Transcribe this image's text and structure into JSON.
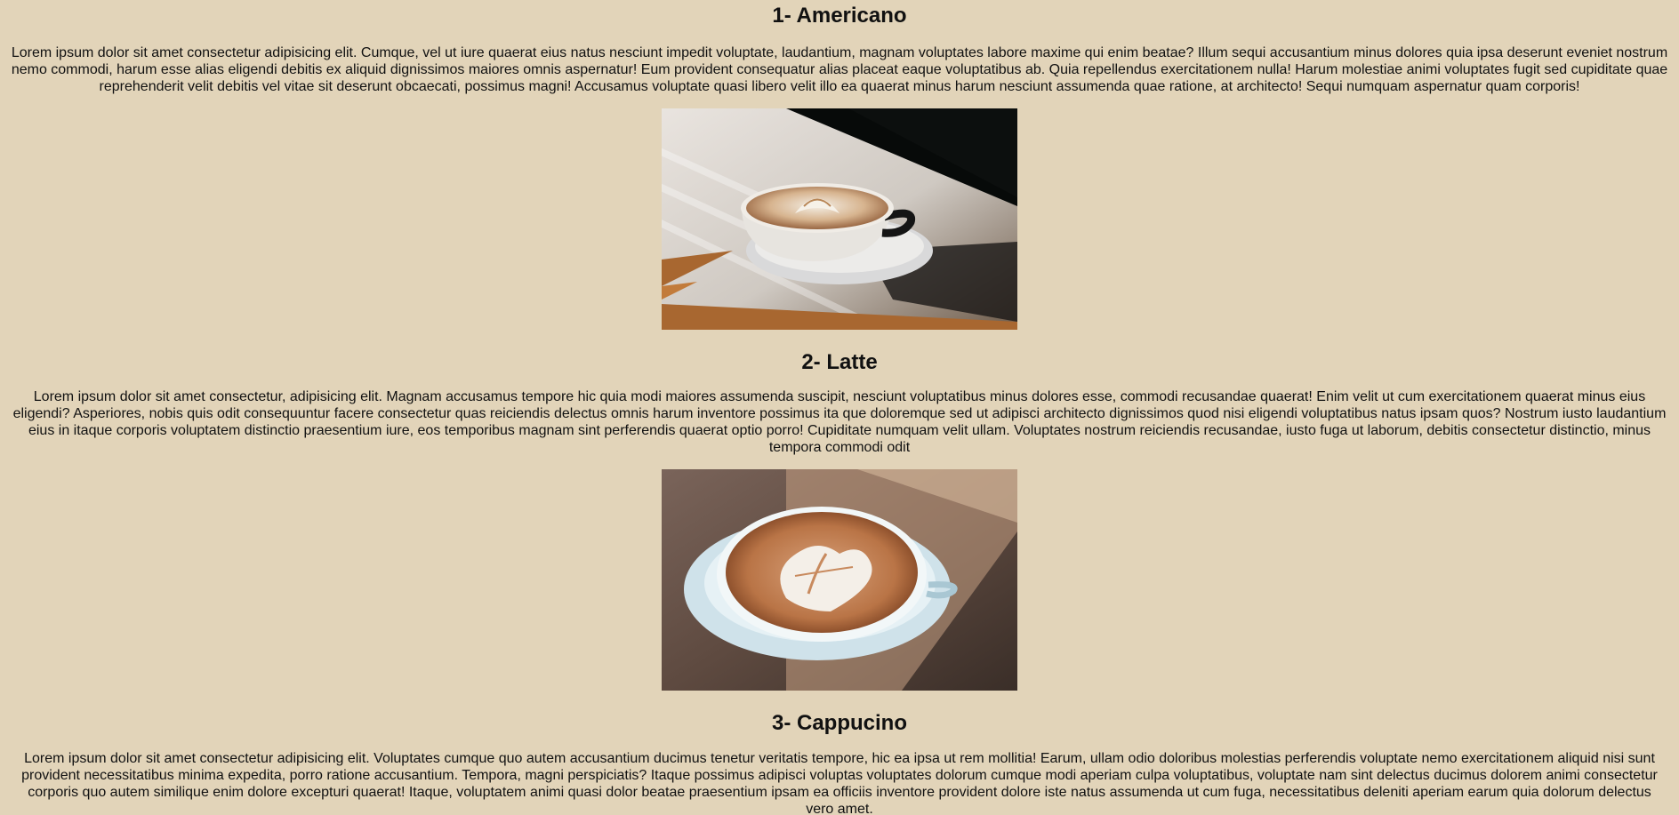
{
  "sections": [
    {
      "title": "1- Americano",
      "text": "Lorem ipsum dolor sit amet consectetur adipisicing elit. Cumque, vel ut iure quaerat eius natus nesciunt impedit voluptate, laudantium, magnam voluptates labore maxime qui enim beatae? Illum sequi accusantium minus dolores quia ipsa deserunt eveniet nostrum nemo commodi, harum esse alias eligendi debitis ex aliquid dignissimos maiores omnis aspernatur! Eum provident consequatur alias placeat eaque voluptatibus ab. Quia repellendus exercitationem nulla! Harum molestiae animi voluptates fugit sed cupiditate quae reprehenderit velit debitis vel vitae sit deserunt obcaecati, possimus magni! Accusamus voluptate quasi libero velit illo ea quaerat minus harum nesciunt assumenda quae ratione, at architecto! Sequi numquam aspernatur quam corporis!",
      "image": "latte-art-cup-photo"
    },
    {
      "title": "2- Latte",
      "text": "Lorem ipsum dolor sit amet consectetur, adipisicing elit. Magnam accusamus tempore hic quia modi maiores assumenda suscipit, nesciunt voluptatibus minus dolores esse, commodi recusandae quaerat! Enim velit ut cum exercitationem quaerat minus eius eligendi? Asperiores, nobis quis odit consequuntur facere consectetur quas reiciendis delectus omnis harum inventore possimus ita que doloremque sed ut adipisci architecto dignissimos quod nisi eligendi voluptatibus natus ipsam quos? Nostrum iusto laudantium eius in itaque corporis voluptatem distinctio praesentium iure, eos temporibus magnam sint perferendis quaerat optio porro! Cupiditate numquam velit ullam. Voluptates nostrum reiciendis recusandae, iusto fuga ut laborum, debitis consectetur distinctio, minus tempora commodi odit",
      "image": "latte-heart-cup-photo"
    },
    {
      "title": "3- Cappucino",
      "text": "Lorem ipsum dolor sit amet consectetur adipisicing elit. Voluptates cumque quo autem accusantium ducimus tenetur veritatis tempore, hic ea ipsa ut rem mollitia! Earum, ullam odio doloribus molestias perferendis voluptate nemo exercitationem aliquid nisi sunt provident necessitatibus minima expedita, porro ratione accusantium. Tempora, magni perspiciatis? Itaque possimus adipisci voluptas voluptates dolorum cumque modi aperiam culpa voluptatibus, voluptate nam sint delectus ducimus dolorem animi consectetur corporis quo autem similique enim dolore excepturi quaerat! Itaque, voluptatem animi quasi dolor beatae praesentium ipsam ea officiis inventore provident dolore iste natus assumenda ut cum fuga, necessitatibus deleniti aperiam earum quia dolorum delectus vero amet."
    }
  ],
  "colors": {
    "background": "#e2d4b9",
    "text": "#111111"
  }
}
